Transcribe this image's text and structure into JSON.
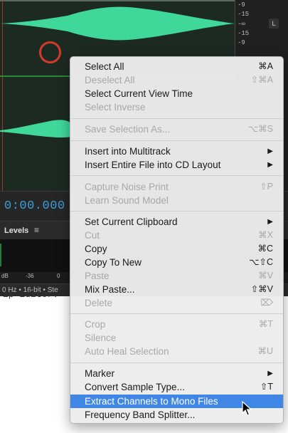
{
  "editor": {
    "ruler_ticks": [
      "-9",
      "-15",
      "-∞",
      "-15",
      "-9"
    ],
    "channel_label": "L",
    "timecode": "0:00.000",
    "levels_title": "Levels",
    "levels_menu_icon": "hamburger-icon",
    "meter_scale": [
      "dB",
      "-36",
      "0"
    ],
    "status": "0 Hz • 16-bit • Ste",
    "doc_text": "ip Editor."
  },
  "colors": {
    "waveform": "#3fd79a",
    "timecode": "#3aa0d8",
    "highlight": "#3f86e6",
    "marker_circle": "#d33a2c"
  },
  "menu": {
    "items": [
      {
        "label": "Select All",
        "shortcut": "⌘A",
        "disabled": false
      },
      {
        "label": "Deselect All",
        "shortcut": "⇧⌘A",
        "disabled": true
      },
      {
        "label": "Select Current View Time",
        "shortcut": "",
        "disabled": false
      },
      {
        "label": "Select Inverse",
        "shortcut": "",
        "disabled": true
      },
      {
        "label": "Save Selection As...",
        "shortcut": "⌥⌘S",
        "disabled": true
      },
      {
        "label": "Insert into Multitrack",
        "shortcut": "",
        "disabled": false,
        "submenu": true
      },
      {
        "label": "Insert Entire File into CD Layout",
        "shortcut": "",
        "disabled": false,
        "submenu": true
      },
      {
        "label": "Capture Noise Print",
        "shortcut": "⇧P",
        "disabled": true
      },
      {
        "label": "Learn Sound Model",
        "shortcut": "",
        "disabled": true
      },
      {
        "label": "Set Current Clipboard",
        "shortcut": "",
        "disabled": false,
        "submenu": true
      },
      {
        "label": "Cut",
        "shortcut": "⌘X",
        "disabled": true
      },
      {
        "label": "Copy",
        "shortcut": "⌘C",
        "disabled": false
      },
      {
        "label": "Copy To New",
        "shortcut": "⌥⇧C",
        "disabled": false
      },
      {
        "label": "Paste",
        "shortcut": "⌘V",
        "disabled": true
      },
      {
        "label": "Mix Paste...",
        "shortcut": "⇧⌘V",
        "disabled": false
      },
      {
        "label": "Delete",
        "shortcut": "⌦",
        "disabled": true
      },
      {
        "label": "Crop",
        "shortcut": "⌘T",
        "disabled": true
      },
      {
        "label": "Silence",
        "shortcut": "",
        "disabled": true
      },
      {
        "label": "Auto Heal Selection",
        "shortcut": "⌘U",
        "disabled": true
      },
      {
        "label": "Marker",
        "shortcut": "",
        "disabled": false,
        "submenu": true
      },
      {
        "label": "Convert Sample Type...",
        "shortcut": "⇧T",
        "disabled": false
      },
      {
        "label": "Extract Channels to Mono Files",
        "shortcut": "",
        "disabled": false,
        "selected": true
      },
      {
        "label": "Frequency Band Splitter...",
        "shortcut": "",
        "disabled": false
      }
    ]
  }
}
